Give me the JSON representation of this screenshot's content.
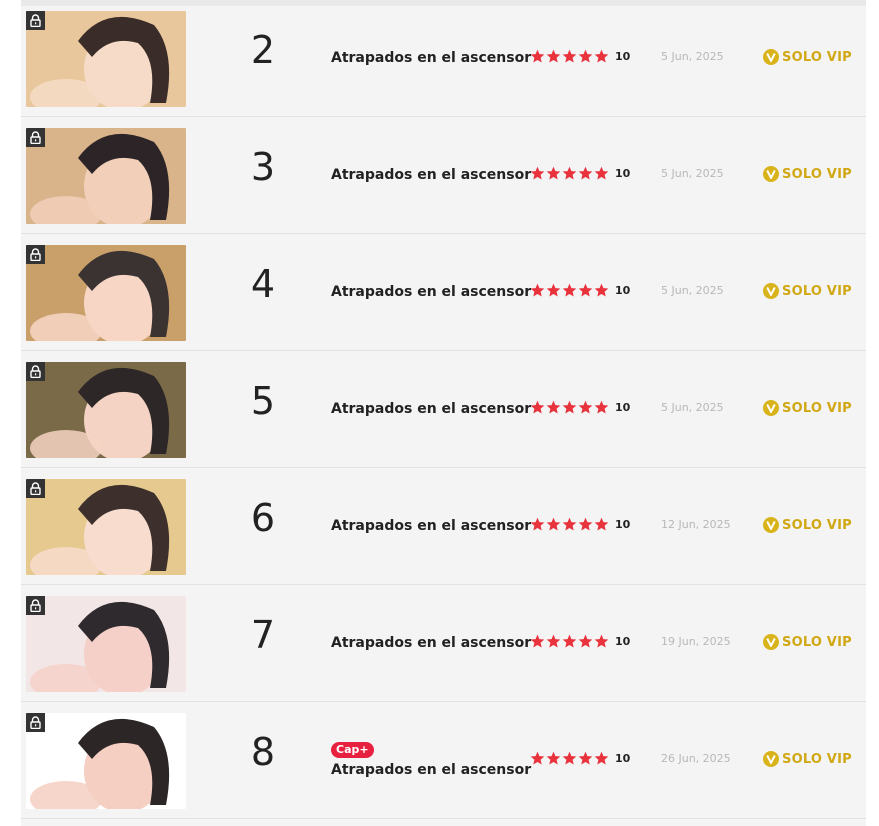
{
  "chapters": [
    {
      "number": "2",
      "title": "Atrapados en el ascensor",
      "rating": "10",
      "stars": 5,
      "date": "5 Jun, 2025",
      "access": "SOLO VIP",
      "badge": "",
      "thumb_colors": [
        "#e8c79c",
        "#3a2c28",
        "#f6dcc8"
      ]
    },
    {
      "number": "3",
      "title": "Atrapados en el ascensor",
      "rating": "10",
      "stars": 5,
      "date": "5 Jun, 2025",
      "access": "SOLO VIP",
      "badge": "",
      "thumb_colors": [
        "#d9b48a",
        "#2c2426",
        "#f1cfb9"
      ]
    },
    {
      "number": "4",
      "title": "Atrapados en el ascensor",
      "rating": "10",
      "stars": 5,
      "date": "5 Jun, 2025",
      "access": "SOLO VIP",
      "badge": "",
      "thumb_colors": [
        "#c9a06a",
        "#3b3332",
        "#f7d6c6"
      ]
    },
    {
      "number": "5",
      "title": "Atrapados en el ascensor",
      "rating": "10",
      "stars": 5,
      "date": "5 Jun, 2025",
      "access": "SOLO VIP",
      "badge": "",
      "thumb_colors": [
        "#7a6a48",
        "#2e2728",
        "#f5d3c4"
      ]
    },
    {
      "number": "6",
      "title": "Atrapados en el ascensor",
      "rating": "10",
      "stars": 5,
      "date": "12 Jun, 2025",
      "access": "SOLO VIP",
      "badge": "",
      "thumb_colors": [
        "#e6c98f",
        "#3d302c",
        "#f8dccd"
      ]
    },
    {
      "number": "7",
      "title": "Atrapados en el ascensor",
      "rating": "10",
      "stars": 5,
      "date": "19 Jun, 2025",
      "access": "SOLO VIP",
      "badge": "",
      "thumb_colors": [
        "#f3e6e6",
        "#2f2a2e",
        "#f4d0c8"
      ]
    },
    {
      "number": "8",
      "title": "Atrapados en el ascensor",
      "rating": "10",
      "stars": 5,
      "date": "26 Jun, 2025",
      "access": "SOLO VIP",
      "badge": "Cap+",
      "thumb_colors": [
        "#ffffff",
        "#2d2626",
        "#f4cfc2"
      ]
    }
  ],
  "icons": {
    "lock": "lock-icon",
    "star": "star-icon",
    "vip": "vip-coin-icon"
  },
  "colors": {
    "star": "#e8323c",
    "vip": "#d1a814",
    "badge": "#e8203f",
    "date": "#b8b8b8"
  }
}
